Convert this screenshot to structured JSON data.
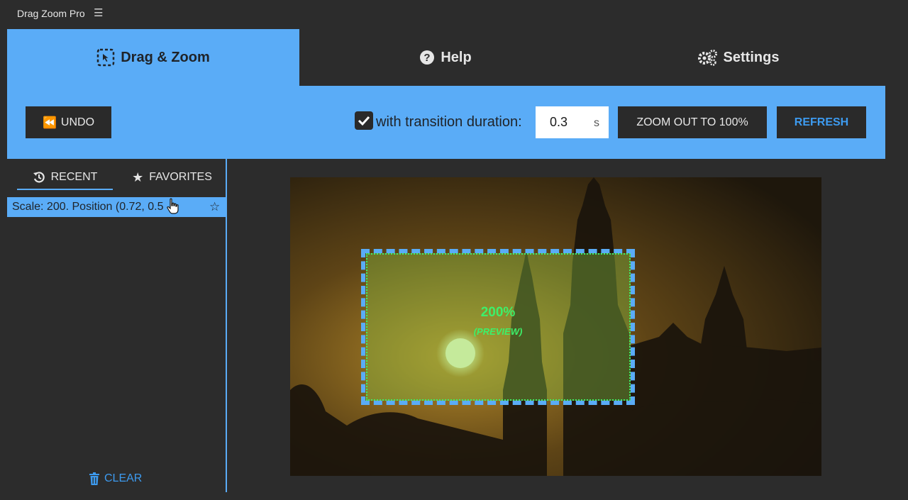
{
  "app": {
    "title": "Drag Zoom Pro",
    "menu_icon": "hamburger-icon"
  },
  "tabs": [
    {
      "label": "Drag & Zoom",
      "icon": "drag-select-icon",
      "active": true
    },
    {
      "label": "Help",
      "icon": "help-circle-icon",
      "active": false
    },
    {
      "label": "Settings",
      "icon": "gears-icon",
      "active": false
    }
  ],
  "toolbar": {
    "undo_label": "UNDO",
    "transition_checked": true,
    "transition_label": "with transition duration:",
    "duration_value": "0.3",
    "duration_unit": "s",
    "zoom_out_label": "ZOOM OUT TO 100%",
    "refresh_label": "REFRESH"
  },
  "history": {
    "tabs": [
      {
        "label": "RECENT",
        "icon": "history-icon",
        "active": true
      },
      {
        "label": "FAVORITES",
        "icon": "star-icon",
        "active": false
      }
    ],
    "items": [
      {
        "text": "Scale: 200. Position (0.72, 0.5"
      }
    ],
    "clear_label": "CLEAR"
  },
  "preview": {
    "scale_label": "200%",
    "preview_label": "(PREVIEW)"
  },
  "colors": {
    "accent": "#5aacf7",
    "refresh_text": "#3d9bf0",
    "zoom_text": "#3df06a",
    "background": "#2c2c2c"
  }
}
